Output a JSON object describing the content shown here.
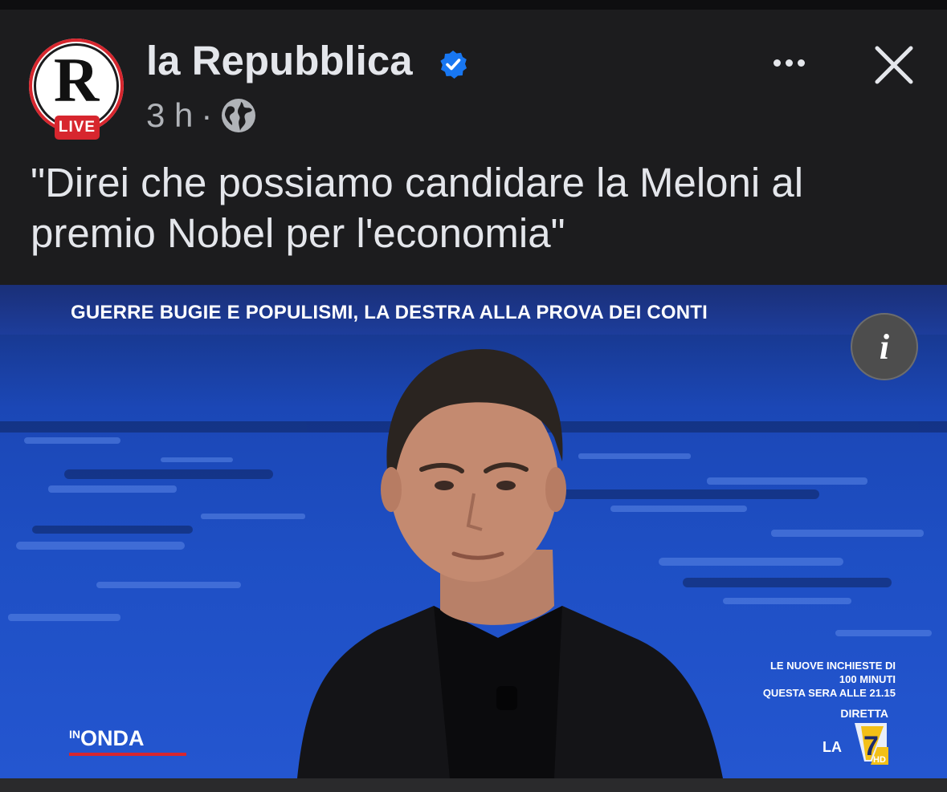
{
  "post": {
    "page_name": "la Repubblica",
    "avatar_letter": "R",
    "live_badge": "LIVE",
    "timestamp": "3 h",
    "separator": "·",
    "audience_icon": "globe-icon",
    "verified_icon": "verified-badge-icon",
    "more_icon": "more-options-icon",
    "close_icon": "close-icon",
    "caption_line1": "\"Direi che possiamo candidare la Meloni al",
    "caption_line2": "premio Nobel per l'economia\""
  },
  "media": {
    "headline": "GUERRE BUGIE E POPULISMI, LA DESTRA ALLA PROVA DEI CONTI",
    "info_label": "i",
    "promo_line1": "LE NUOVE INCHIESTE DI",
    "promo_line2": "100 MINUTI",
    "promo_line3": "QUESTA SERA ALLE 21.15",
    "diretta": "DIRETTA",
    "channel_prefix": "LA",
    "channel_number": "7",
    "channel_hd": "HD",
    "show_prefix": "IN",
    "show_name": "ONDA"
  },
  "colors": {
    "background": "#1c1c1e",
    "text_primary": "#e4e6eb",
    "text_secondary": "#b0b3b8",
    "verified_blue": "#1877f2",
    "brand_red": "#d7262e",
    "studio_blue": "#1b3d8f"
  }
}
